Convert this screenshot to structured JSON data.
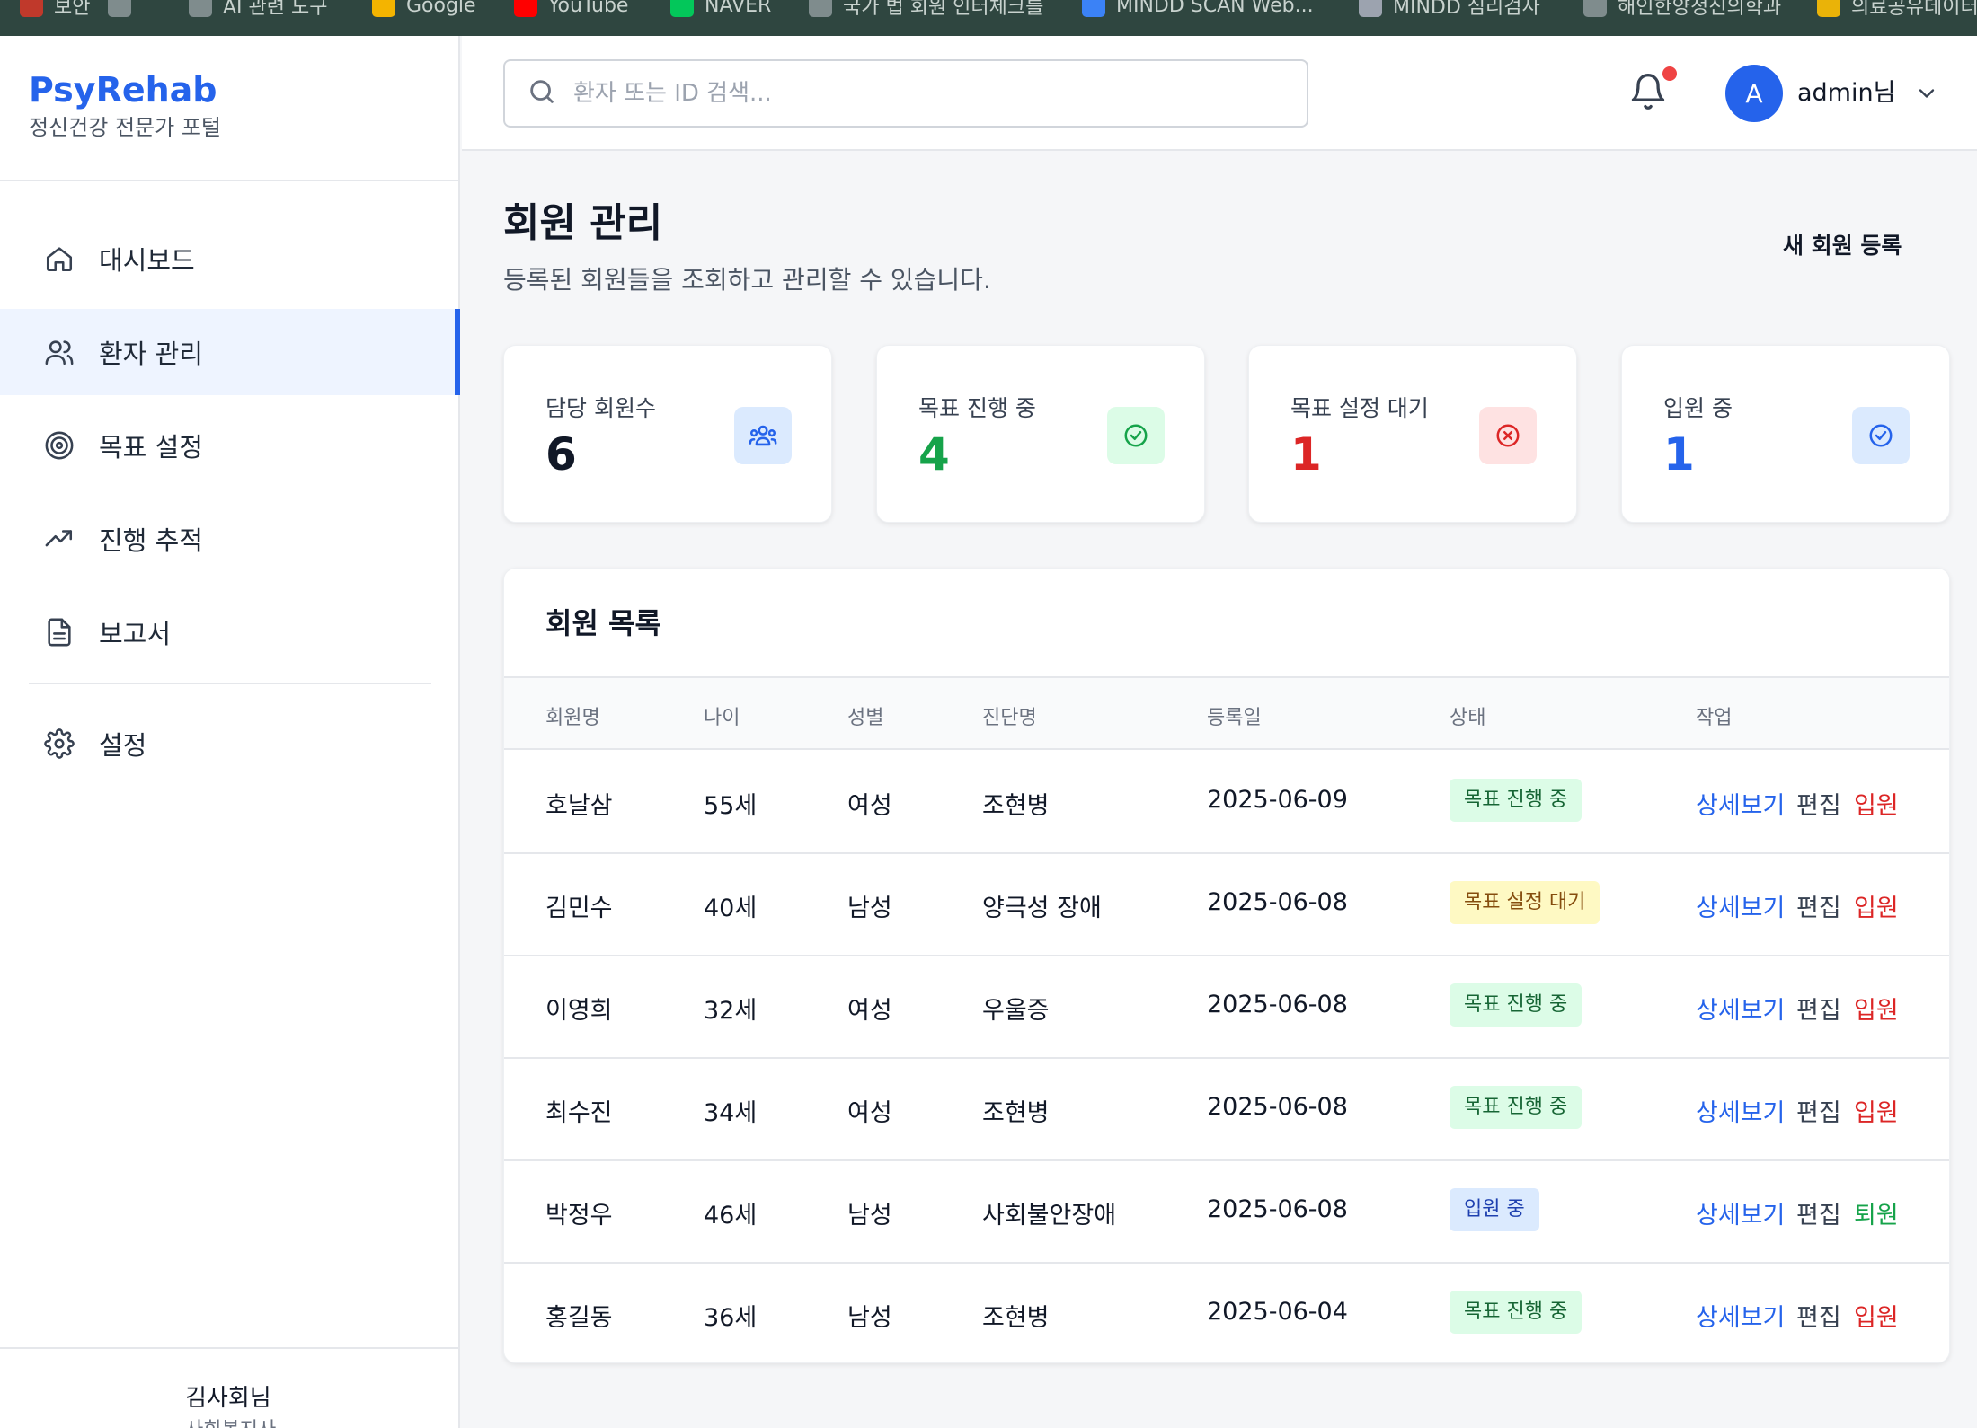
{
  "browser": {
    "bookmarks": [
      {
        "label": "보안",
        "color": "#c0392b"
      },
      {
        "label": "",
        "color": "#7f8c8d"
      },
      {
        "label": "AI 관련 도구",
        "color": "#7f8c8d"
      },
      {
        "label": "Google",
        "color": "#f4b400"
      },
      {
        "label": "YouTube",
        "color": "#ff0000"
      },
      {
        "label": "NAVER",
        "color": "#03c75a"
      },
      {
        "label": "국가 법 회원 인터체크를",
        "color": "#7f8c8d"
      },
      {
        "label": "MINDD SCAN Web...",
        "color": "#3b82f6"
      },
      {
        "label": "MINDD 심리검사",
        "color": "#9ca3af"
      },
      {
        "label": "해인한양정신의학과",
        "color": "#7f8c8d"
      },
      {
        "label": "의료공유데이터",
        "color": "#eab308"
      }
    ]
  },
  "sidebar": {
    "brand_title": "PsyRehab",
    "brand_subtitle": "정신건강 전문가 포털",
    "items": [
      {
        "label": "대시보드",
        "icon": "home-icon",
        "active": false
      },
      {
        "label": "환자 관리",
        "icon": "users-icon",
        "active": true
      },
      {
        "label": "목표 설정",
        "icon": "target-icon",
        "active": false
      },
      {
        "label": "진행 추적",
        "icon": "trend-icon",
        "active": false
      },
      {
        "label": "보고서",
        "icon": "document-icon",
        "active": false
      }
    ],
    "settings_label": "설정",
    "footer_user": "김사회님",
    "footer_role": "사회복지사"
  },
  "header": {
    "search_placeholder": "환자 또는 ID 검색...",
    "avatar_initial": "A",
    "user_name": "admin님"
  },
  "page": {
    "title": "회원 관리",
    "description": "등록된 회원들을 조회하고 관리할 수 있습니다.",
    "new_member_label": "새 회원 등록"
  },
  "stats": [
    {
      "label": "담당 회원수",
      "value": "6",
      "value_color": "#111827",
      "icon": "group-icon",
      "icon_bg": "#dbeafe",
      "icon_color": "#2563eb"
    },
    {
      "label": "목표 진행 중",
      "value": "4",
      "value_color": "#16a34a",
      "icon": "check-circle-icon",
      "icon_bg": "#dcfce7",
      "icon_color": "#16a34a"
    },
    {
      "label": "목표 설정 대기",
      "value": "1",
      "value_color": "#dc2626",
      "icon": "x-circle-icon",
      "icon_bg": "#fee2e2",
      "icon_color": "#dc2626"
    },
    {
      "label": "입원 중",
      "value": "1",
      "value_color": "#2563eb",
      "icon": "check-circle-icon",
      "icon_bg": "#dbeafe",
      "icon_color": "#2563eb"
    }
  ],
  "table": {
    "title": "회원 목록",
    "columns": [
      "회원명",
      "나이",
      "성별",
      "진단명",
      "등록일",
      "상태",
      "작업"
    ],
    "action_detail": "상세보기",
    "action_edit": "편집",
    "rows": [
      {
        "name": "호날삼",
        "age": "55세",
        "gender": "여성",
        "diagnosis": "조현병",
        "date": "2025-06-09",
        "status": "목표 진행 중",
        "status_type": "progress",
        "admit_label": "입원",
        "admit_color": "#dc2626"
      },
      {
        "name": "김민수",
        "age": "40세",
        "gender": "남성",
        "diagnosis": "양극성 장애",
        "date": "2025-06-08",
        "status": "목표 설정 대기",
        "status_type": "waiting",
        "admit_label": "입원",
        "admit_color": "#dc2626"
      },
      {
        "name": "이영희",
        "age": "32세",
        "gender": "여성",
        "diagnosis": "우울증",
        "date": "2025-06-08",
        "status": "목표 진행 중",
        "status_type": "progress",
        "admit_label": "입원",
        "admit_color": "#dc2626"
      },
      {
        "name": "최수진",
        "age": "34세",
        "gender": "여성",
        "diagnosis": "조현병",
        "date": "2025-06-08",
        "status": "목표 진행 중",
        "status_type": "progress",
        "admit_label": "입원",
        "admit_color": "#dc2626"
      },
      {
        "name": "박정우",
        "age": "46세",
        "gender": "남성",
        "diagnosis": "사회불안장애",
        "date": "2025-06-08",
        "status": "입원 중",
        "status_type": "admitted",
        "admit_label": "퇴원",
        "admit_color": "#16a34a"
      },
      {
        "name": "홍길동",
        "age": "36세",
        "gender": "남성",
        "diagnosis": "조현병",
        "date": "2025-06-04",
        "status": "목표 진행 중",
        "status_type": "progress",
        "admit_label": "입원",
        "admit_color": "#dc2626"
      }
    ]
  },
  "colors": {
    "accent": "#2563eb",
    "link_blue": "#2563eb",
    "badge_progress_bg": "#dcfce7",
    "badge_progress_fg": "#166534",
    "badge_waiting_bg": "#fef9c3",
    "badge_waiting_fg": "#854d0e",
    "badge_admitted_bg": "#dbeafe",
    "badge_admitted_fg": "#1e40af"
  }
}
